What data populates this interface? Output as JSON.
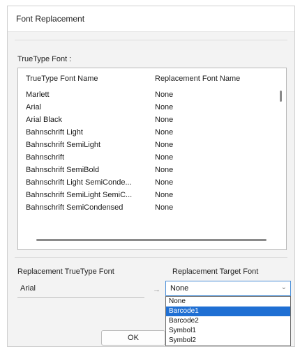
{
  "window": {
    "title": "Font Replacement"
  },
  "truetype_group": {
    "label": "TrueType Font :",
    "columns": [
      "TrueType Font Name",
      "Replacement Font Name"
    ],
    "rows": [
      {
        "name": "Marlett",
        "replacement": "None"
      },
      {
        "name": "Arial",
        "replacement": "None"
      },
      {
        "name": "Arial Black",
        "replacement": "None"
      },
      {
        "name": "Bahnschrift Light",
        "replacement": "None"
      },
      {
        "name": "Bahnschrift SemiLight",
        "replacement": "None"
      },
      {
        "name": "Bahnschrift",
        "replacement": "None"
      },
      {
        "name": "Bahnschrift SemiBold",
        "replacement": "None"
      },
      {
        "name": "Bahnschrift Light SemiConde...",
        "replacement": "None"
      },
      {
        "name": "Bahnschrift SemiLight SemiC...",
        "replacement": "None"
      },
      {
        "name": "Bahnschrift SemiCondensed",
        "replacement": "None"
      }
    ]
  },
  "replacement": {
    "source_label": "Replacement TrueType Font",
    "source_value": "Arial",
    "arrow": "→",
    "target_label": "Replacement Target Font",
    "target_value": "None",
    "options": [
      "None",
      "Barcode1",
      "Barcode2",
      "Symbol1",
      "Symbol2"
    ],
    "highlighted_option": "Barcode1"
  },
  "buttons": {
    "ok": "OK"
  },
  "colors": {
    "selection": "#1f6fd3",
    "focus_border": "#4a8fd8"
  }
}
